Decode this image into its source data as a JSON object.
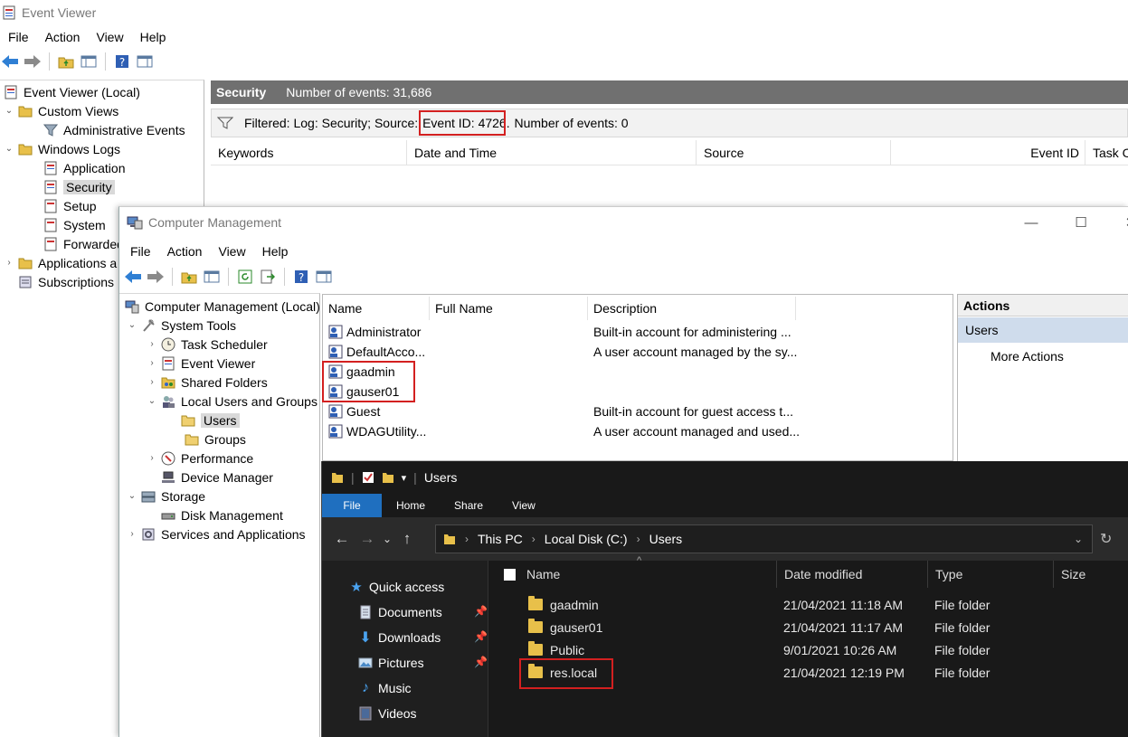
{
  "event_viewer": {
    "title": "Event Viewer",
    "menu": [
      "File",
      "Action",
      "View",
      "Help"
    ],
    "tree": [
      {
        "label": "Event Viewer (Local)"
      },
      {
        "label": "Custom Views"
      },
      {
        "label": "Administrative Events"
      },
      {
        "label": "Windows Logs"
      },
      {
        "label": "Application"
      },
      {
        "label": "Security"
      },
      {
        "label": "Setup"
      },
      {
        "label": "System"
      },
      {
        "label": "Forwarded"
      },
      {
        "label": "Applications a"
      },
      {
        "label": "Subscriptions"
      }
    ],
    "header": {
      "log": "Security",
      "count": "Number of events: 31,686"
    },
    "filter": {
      "prefix": "Filtered: Log: Security; Source: ",
      "event_id": "Event ID: 4726.",
      "suffix": " Number of events: 0"
    },
    "columns": [
      "Keywords",
      "Date and Time",
      "Source",
      "Event ID",
      "Task Ca"
    ]
  },
  "computer_management": {
    "title": "Computer Management",
    "menu": [
      "File",
      "Action",
      "View",
      "Help"
    ],
    "window_controls": {
      "minimize": "—",
      "maximize": "☐",
      "close": "✕"
    },
    "tree": [
      {
        "label": "Computer Management (Local)"
      },
      {
        "label": "System Tools"
      },
      {
        "label": "Task Scheduler"
      },
      {
        "label": "Event Viewer"
      },
      {
        "label": "Shared Folders"
      },
      {
        "label": "Local Users and Groups"
      },
      {
        "label": "Users"
      },
      {
        "label": "Groups"
      },
      {
        "label": "Performance"
      },
      {
        "label": "Device Manager"
      },
      {
        "label": "Storage"
      },
      {
        "label": "Disk Management"
      },
      {
        "label": "Services and Applications"
      }
    ],
    "list_columns": [
      "Name",
      "Full Name",
      "Description"
    ],
    "users": [
      {
        "name": "Administrator",
        "full_name": "",
        "description": "Built-in account for administering ..."
      },
      {
        "name": "DefaultAcco...",
        "full_name": "",
        "description": "A user account managed by the sy..."
      },
      {
        "name": "gaadmin",
        "full_name": "",
        "description": ""
      },
      {
        "name": "gauser01",
        "full_name": "",
        "description": ""
      },
      {
        "name": "Guest",
        "full_name": "",
        "description": "Built-in account for guest access t..."
      },
      {
        "name": "WDAGUtility...",
        "full_name": "",
        "description": "A user account managed and used..."
      }
    ],
    "actions": {
      "header": "Actions",
      "selected": "Users",
      "more": "More Actions"
    }
  },
  "file_explorer": {
    "title": "Users",
    "tabs": [
      "File",
      "Home",
      "Share",
      "View"
    ],
    "path": [
      "This PC",
      "Local Disk (C:)",
      "Users"
    ],
    "nav_pane": [
      {
        "label": "Quick access",
        "icon": "star-icon"
      },
      {
        "label": "Documents",
        "icon": "documents-icon",
        "pinned": true
      },
      {
        "label": "Downloads",
        "icon": "downloads-icon",
        "pinned": true
      },
      {
        "label": "Pictures",
        "icon": "pictures-icon",
        "pinned": true
      },
      {
        "label": "Music",
        "icon": "music-icon"
      },
      {
        "label": "Videos",
        "icon": "videos-icon"
      }
    ],
    "columns": [
      "Name",
      "Date modified",
      "Type",
      "Size"
    ],
    "files": [
      {
        "name": "gaadmin",
        "date": "21/04/2021 11:18 AM",
        "type": "File folder"
      },
      {
        "name": "gauser01",
        "date": "21/04/2021 11:17 AM",
        "type": "File folder"
      },
      {
        "name": "Public",
        "date": "9/01/2021 10:26 AM",
        "type": "File folder"
      },
      {
        "name": "res.local",
        "date": "21/04/2021 12:19 PM",
        "type": "File folder"
      }
    ]
  },
  "colors": {
    "highlight_box": "#d32020",
    "explorer_bg": "#191919",
    "file_tab": "#1f6fbf",
    "selection": "#cfdcec"
  }
}
